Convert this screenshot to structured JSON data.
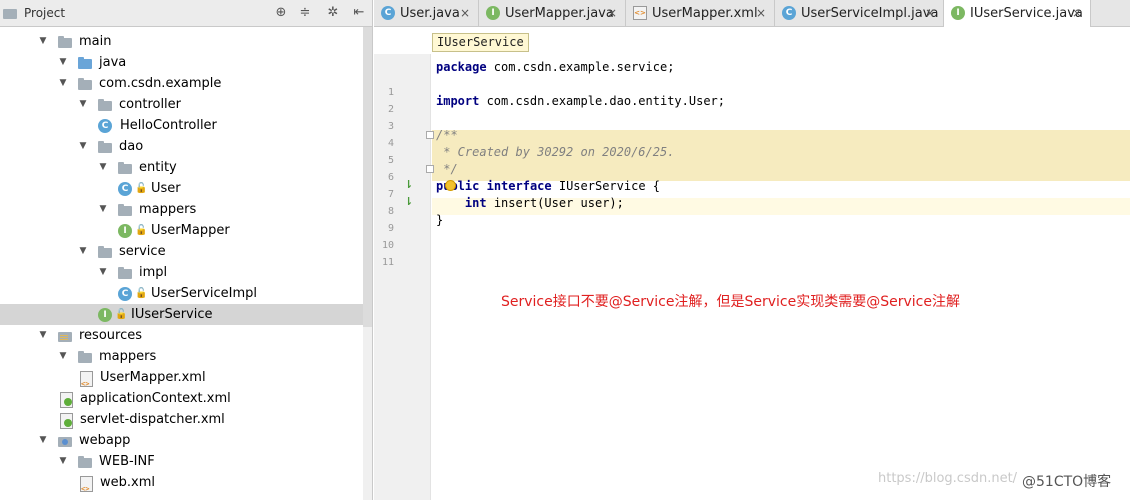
{
  "project_panel": {
    "title": "Project",
    "tools": [
      "crosshair-icon",
      "collapse-all-icon",
      "settings-icon",
      "hide-icon"
    ],
    "tree": [
      {
        "label": "main",
        "icon": "folder-icon",
        "expanded": true
      },
      {
        "label": "java",
        "icon": "source-folder-icon",
        "expanded": true
      },
      {
        "label": "com.csdn.example",
        "icon": "package-icon",
        "expanded": true
      },
      {
        "label": "controller",
        "icon": "package-icon",
        "expanded": true
      },
      {
        "label": "HelloController",
        "icon": "class-icon"
      },
      {
        "label": "dao",
        "icon": "package-icon",
        "expanded": true
      },
      {
        "label": "entity",
        "icon": "package-icon",
        "expanded": true
      },
      {
        "label": "User",
        "icon": "class-icon"
      },
      {
        "label": "mappers",
        "icon": "package-icon",
        "expanded": true
      },
      {
        "label": "UserMapper",
        "icon": "interface-icon"
      },
      {
        "label": "service",
        "icon": "package-icon",
        "expanded": true
      },
      {
        "label": "impl",
        "icon": "package-icon",
        "expanded": true
      },
      {
        "label": "UserServiceImpl",
        "icon": "class-icon"
      },
      {
        "label": "IUserService",
        "icon": "interface-icon",
        "selected": true
      },
      {
        "label": "resources",
        "icon": "resources-folder-icon",
        "expanded": true
      },
      {
        "label": "mappers",
        "icon": "folder-icon",
        "expanded": true
      },
      {
        "label": "UserMapper.xml",
        "icon": "xml-file-icon"
      },
      {
        "label": "applicationContext.xml",
        "icon": "spring-xml-icon"
      },
      {
        "label": "servlet-dispatcher.xml",
        "icon": "spring-xml-icon"
      },
      {
        "label": "webapp",
        "icon": "web-folder-icon",
        "expanded": true
      },
      {
        "label": "WEB-INF",
        "icon": "folder-icon",
        "expanded": true
      },
      {
        "label": "web.xml",
        "icon": "xml-file-icon"
      }
    ]
  },
  "tabs": [
    {
      "label": "User.java",
      "icon": "C",
      "active": false
    },
    {
      "label": "UserMapper.java",
      "icon": "I",
      "active": false
    },
    {
      "label": "UserMapper.xml",
      "icon": "xml",
      "active": false
    },
    {
      "label": "UserServiceImpl.java",
      "icon": "C",
      "active": false
    },
    {
      "label": "IUserService.java",
      "icon": "I",
      "active": true
    }
  ],
  "tab_close_glyph": "×",
  "breadcrumb": "IUserService",
  "editor": {
    "line_numbers": [
      "1",
      "2",
      "3",
      "4",
      "5",
      "6",
      "7",
      "8",
      "9",
      "10",
      "11"
    ],
    "lines": [
      "package com.csdn.example.service;",
      "",
      "import com.csdn.example.dao.entity.User;",
      "",
      "/**",
      " * Created by 30292 on 2020/6/25.",
      " */",
      "public interface IUserService {",
      "    int insert(User user);",
      "}",
      ""
    ]
  },
  "annotation": "Service接口不要@Service注解，但是Service实现类需要@Service注解",
  "watermark": "https://blog.csdn.net/",
  "watermark_brand": "@51CTO博客"
}
